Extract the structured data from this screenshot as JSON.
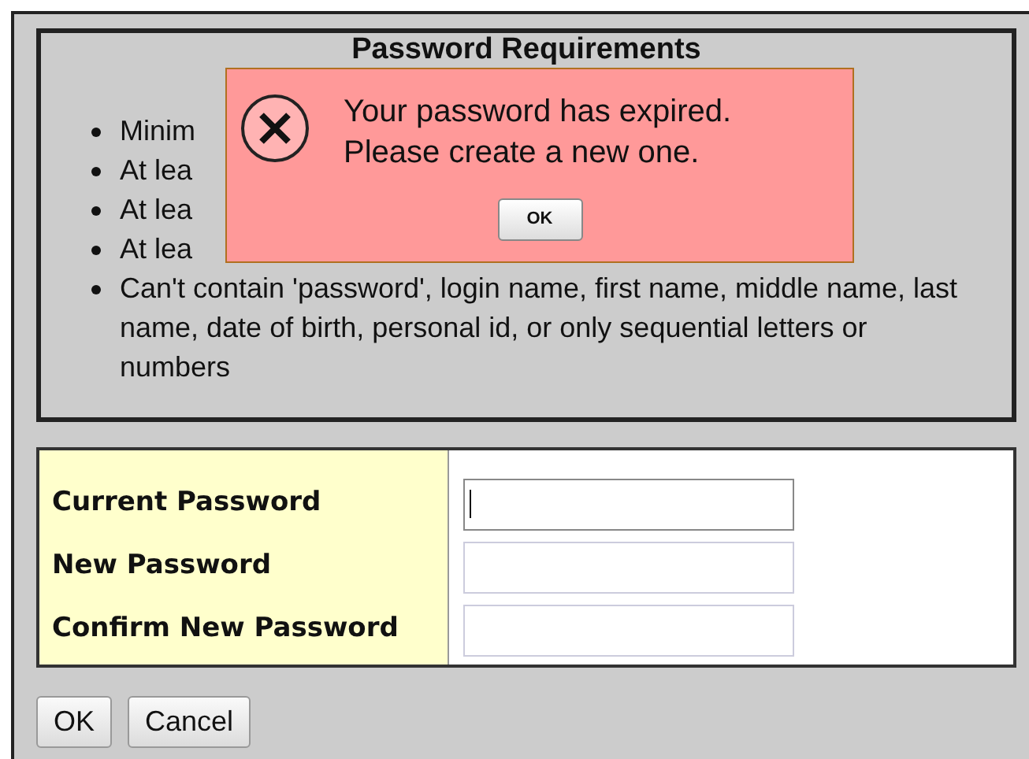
{
  "requirements": {
    "title": "Password Requirements",
    "items": [
      "Minim",
      "At lea",
      "At lea",
      "At lea",
      "Can't contain 'password', login name, first name, middle name, last name, date of birth, personal id, or only sequential letters or numbers"
    ]
  },
  "form": {
    "fields": [
      {
        "label": "Current Password",
        "focused": true
      },
      {
        "label": "New Password",
        "focused": false
      },
      {
        "label": "Confirm New Password",
        "focused": false
      }
    ]
  },
  "buttons": [
    "OK",
    "Cancel"
  ],
  "alert": {
    "lines": [
      "Your password has expired.",
      "Please create a new one."
    ],
    "button": "OK"
  }
}
